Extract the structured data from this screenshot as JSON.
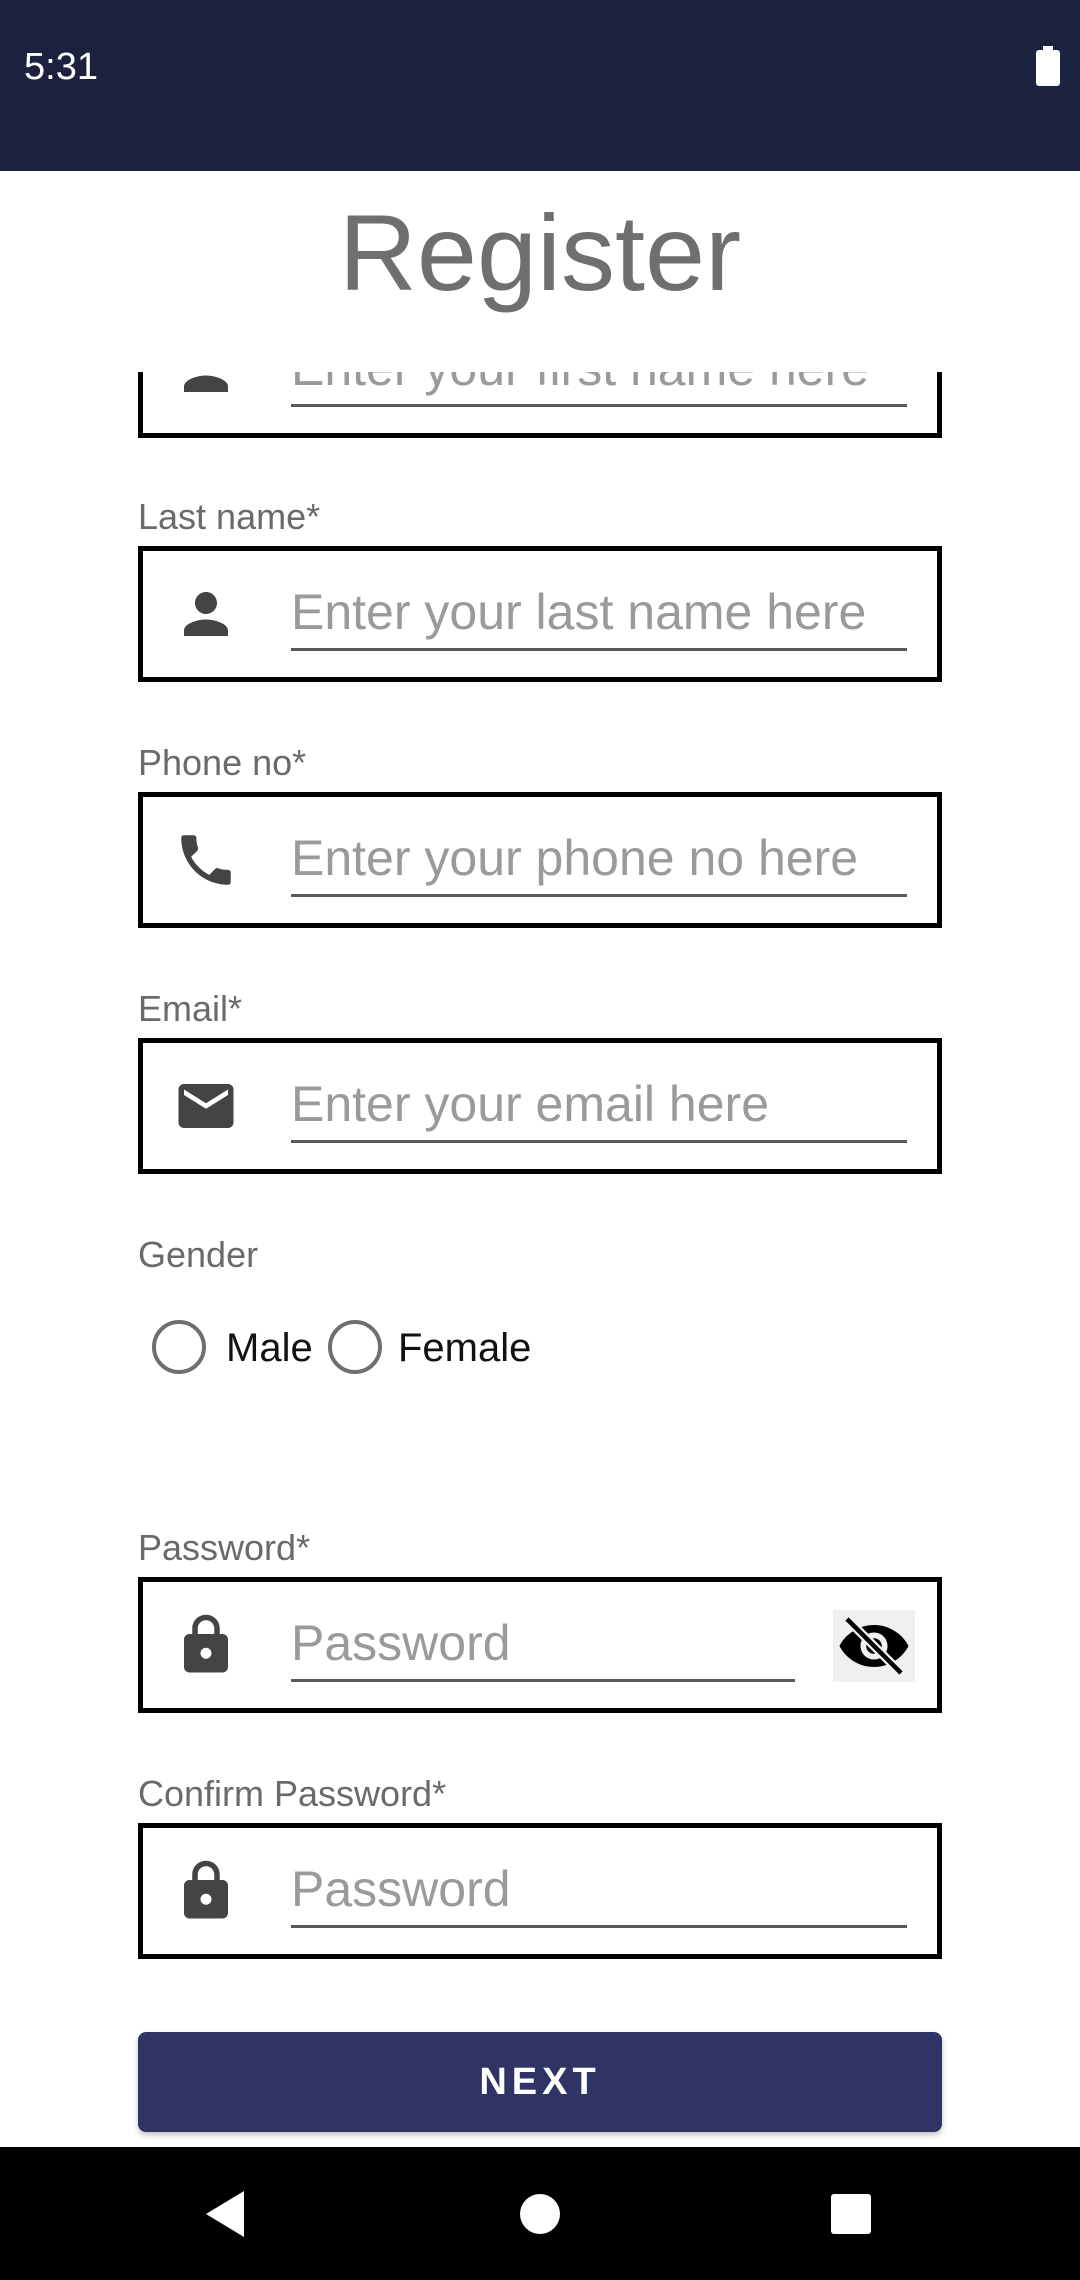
{
  "status_bar": {
    "time": "5:31",
    "battery_icon": "battery-full-icon"
  },
  "page": {
    "title": "Register"
  },
  "form": {
    "first_name": {
      "icon": "person-icon",
      "placeholder": "Enter your first name here"
    },
    "last_name": {
      "label": "Last name*",
      "icon": "person-icon",
      "placeholder": "Enter your last name here"
    },
    "phone": {
      "label": "Phone no*",
      "icon": "phone-icon",
      "placeholder": "Enter your phone no here"
    },
    "email": {
      "label": "Email*",
      "icon": "mail-icon",
      "placeholder": "Enter your email here"
    },
    "gender": {
      "label": "Gender",
      "options": [
        "Male",
        "Female"
      ]
    },
    "password": {
      "label": "Password*",
      "icon": "lock-icon",
      "placeholder": "Password",
      "toggle_icon": "visibility-off-icon"
    },
    "confirm_password": {
      "label": "Confirm Password*",
      "icon": "lock-icon",
      "placeholder": "Password"
    },
    "next_label": "NEXT"
  },
  "nav_bar": {
    "back_icon": "back-triangle-icon",
    "home_icon": "home-circle-icon",
    "recents_icon": "recents-square-icon"
  },
  "colors": {
    "status_bar": "#1d2140",
    "button": "#2f3464",
    "title": "#6f6f6f"
  }
}
